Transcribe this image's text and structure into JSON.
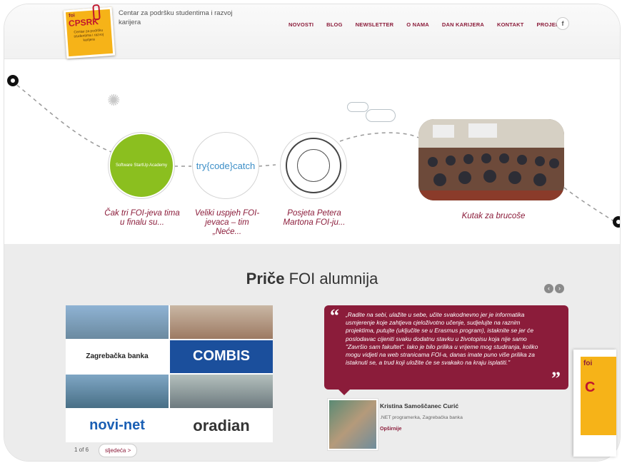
{
  "header": {
    "logo": {
      "foi": "foi",
      "name": "CPSRK",
      "sub": "Centar za podršku studentima i razvoj karijera"
    },
    "tagline": "Centar za podršku studentima i razvoj karijera",
    "nav": [
      "NOVOSTI",
      "BLOG",
      "NEWSLETTER",
      "O NAMA",
      "DAN KARIJERA",
      "KONTAKT",
      "PROJEKT"
    ],
    "social": "f"
  },
  "timeline": {
    "items": [
      {
        "circle_text": "Software StartUp Academy",
        "caption": "Čak tri FOI-jeva tima u finalu su..."
      },
      {
        "circle_text": "try{code}catch",
        "caption": "Veliki uspjeh FOI-jevaca – tim „Neće..."
      },
      {
        "circle_text": "",
        "caption": "Posjeta Petera Martona FOI-ju..."
      },
      {
        "circle_text": "",
        "caption": "Kutak za brucoše"
      }
    ]
  },
  "alumni": {
    "title_bold": "Priče",
    "title_rest": " FOI alumnija",
    "logos": [
      "Zagrebačka banka",
      "COMBIS",
      "novi-net",
      "oradian"
    ],
    "pager": "1 of 6",
    "next": "sljedeća >",
    "quote": "„Radite na sebi, ulažite u sebe, učite svakodnevno jer je informatika usmjerenje koje zahtjeva cjeloživotno učenje, sudjelujte na raznim projektima, putujte (uključite se u Erasmus program), istaknite se jer će poslodavac cijeniti svaku dodatnu stavku u životopisu koja nije samo \"Završio sam fakultet\". Iako je bilo prilika u vrijeme mog studiranja, koliko mogu vidjeti na web stranicama FOI-a, danas imate puno više prilika za istaknuti se, a trud koji uložite će se svakako na kraju isplatiti.\"",
    "person_name": "Kristina Samoščanec Curić",
    "person_role": ".NET programerka, Zagrebačka banka",
    "more": "Opširnije"
  },
  "colors": {
    "brand": "#8b1c3a",
    "accent": "#f6b318",
    "green": "#8bbf1f"
  }
}
